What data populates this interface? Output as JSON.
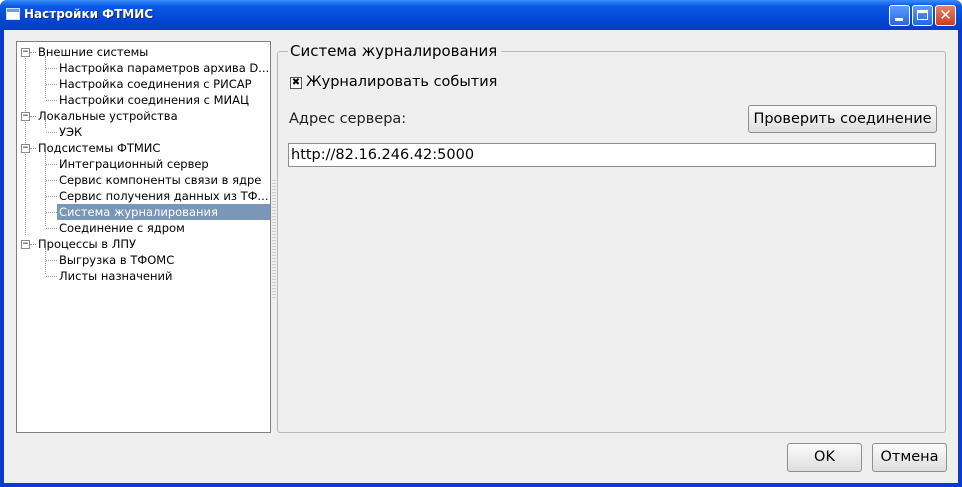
{
  "window": {
    "title": "Настройки ФТМИС",
    "icon": "app-window-icon",
    "controls": [
      "minimize-icon",
      "maximize-icon",
      "close-icon"
    ],
    "close_glyph": "✕"
  },
  "tree": {
    "expander_glyph": "−",
    "nodes": [
      {
        "label": "Внешние системы",
        "level": 0,
        "expanded": true
      },
      {
        "label": "Настройка параметров архива D...",
        "level": 1
      },
      {
        "label": "Настройка соединения с РИСАР",
        "level": 1
      },
      {
        "label": "Настройки соединения с МИАЦ",
        "level": 1
      },
      {
        "label": "Локальные устройства",
        "level": 0,
        "expanded": true
      },
      {
        "label": "УЭК",
        "level": 1
      },
      {
        "label": "Подсистемы ФТМИС",
        "level": 0,
        "expanded": true
      },
      {
        "label": "Интеграционный сервер",
        "level": 1
      },
      {
        "label": "Сервис компоненты связи в ядре",
        "level": 1
      },
      {
        "label": "Сервис получения данных из ТФ...",
        "level": 1
      },
      {
        "label": "Система журналирования",
        "level": 1,
        "selected": true
      },
      {
        "label": "Соединение с ядром",
        "level": 1
      },
      {
        "label": "Процессы в ЛПУ",
        "level": 0,
        "expanded": true
      },
      {
        "label": "Выгрузка в ТФОМС",
        "level": 1
      },
      {
        "label": "Листы назначений",
        "level": 1
      }
    ]
  },
  "panel": {
    "group_title": "Система журналирования",
    "log_events": {
      "label": "Журналировать события",
      "checked": true,
      "check_glyph": "✖"
    },
    "server_address_label": "Адрес сервера:",
    "check_connection_label": "Проверить соединение",
    "server_address_value": "http://82.16.246.42:5000"
  },
  "footer": {
    "ok_label": "OK",
    "cancel_label": "Отмена"
  },
  "colors": {
    "selection": "#7a96b8",
    "titlebar": "#0548d8",
    "background": "#efefef"
  }
}
